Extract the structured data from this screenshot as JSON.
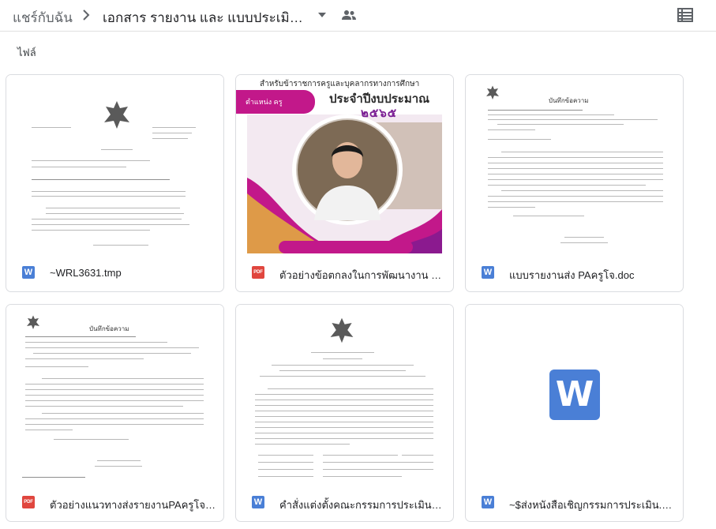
{
  "breadcrumb": {
    "root": "แชร์กับฉัน",
    "current": "เอกสาร รายงาน และ แบบประเมิน ..."
  },
  "section_label": "ไฟล์",
  "icons": {
    "chevron": "chevron-right-icon",
    "caret": "arrow-drop-down-icon",
    "shared": "people-icon",
    "view": "list-view-icon"
  },
  "colors": {
    "word": "#4a7fd6",
    "pdf": "#e0463e",
    "cover_magenta": "#c2188a"
  },
  "files": [
    {
      "name": "~WRL3631.tmp",
      "type": "word",
      "type_label": "W"
    },
    {
      "name": "ตัวอย่างข้อตกลงในการพัฒนางาน PA...",
      "type": "pdf",
      "type_label": "PDF"
    },
    {
      "name": "แบบรายงานส่ง PAครูโจ.doc",
      "type": "word",
      "type_label": "W"
    },
    {
      "name": "ตัวอย่างแนวทางส่งรายงานPAครูโจ.pdf",
      "type": "pdf",
      "type_label": "PDF"
    },
    {
      "name": "คำสั่งแต่งตั้งคณะกรรมการประเมินผล...",
      "type": "word",
      "type_label": "W"
    },
    {
      "name": "~$ส่งหนังสือเชิญกรรมการประเมิน.do...",
      "type": "word",
      "type_label": "W"
    }
  ],
  "thumbnails": {
    "doc1_heading": "บันทึกข้อความ",
    "doc3_heading": "บันทึกข้อความ",
    "doc4_heading": "บันทึกข้อความ",
    "big_word_letter": "W",
    "cover": {
      "line1": "สำหรับข้าราชการครูและบุคลากรทางการศึกษา",
      "line2": "ประจำปีงบประมาณ",
      "year": "๒๕๖๕",
      "badge": "ตำแหน่ง ครู"
    }
  }
}
